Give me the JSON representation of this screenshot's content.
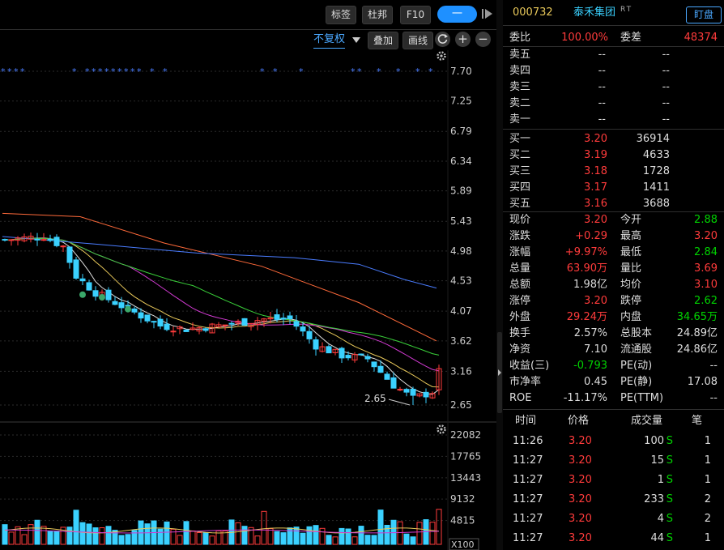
{
  "toolbar": {
    "tag_label": "标签",
    "dubang_label": "杜邦",
    "f10_label": "F10",
    "minus_label": "一",
    "fuquan_label": "不复权",
    "overlay_label": "叠加",
    "draw_label": "画线"
  },
  "stock": {
    "code": "000732",
    "name": "泰禾集团",
    "badges": "RT",
    "watch_label": "盯盘"
  },
  "order_book": {
    "weibi_label": "委比",
    "weibi_value": "100.00%",
    "weicha_label": "委差",
    "weicha_value": "48374",
    "asks": [
      {
        "label": "卖五",
        "price": "--",
        "volume": "--"
      },
      {
        "label": "卖四",
        "price": "--",
        "volume": "--"
      },
      {
        "label": "卖三",
        "price": "--",
        "volume": "--"
      },
      {
        "label": "卖二",
        "price": "--",
        "volume": "--"
      },
      {
        "label": "卖一",
        "price": "--",
        "volume": "--"
      }
    ],
    "bids": [
      {
        "label": "买一",
        "price": "3.20",
        "volume": "36914"
      },
      {
        "label": "买二",
        "price": "3.19",
        "volume": "4633"
      },
      {
        "label": "买三",
        "price": "3.18",
        "volume": "1728"
      },
      {
        "label": "买四",
        "price": "3.17",
        "volume": "1411"
      },
      {
        "label": "买五",
        "price": "3.16",
        "volume": "3688"
      }
    ]
  },
  "quote": [
    {
      "l1": "现价",
      "v1": "3.20",
      "c1": "red",
      "l2": "今开",
      "v2": "2.88",
      "c2": "green"
    },
    {
      "l1": "涨跌",
      "v1": "+0.29",
      "c1": "red",
      "l2": "最高",
      "v2": "3.20",
      "c2": "red"
    },
    {
      "l1": "涨幅",
      "v1": "+9.97%",
      "c1": "red",
      "l2": "最低",
      "v2": "2.84",
      "c2": "green"
    },
    {
      "l1": "总量",
      "v1": "63.90万",
      "c1": "red",
      "l2": "量比",
      "v2": "3.69",
      "c2": "red"
    },
    {
      "l1": "总额",
      "v1": "1.98亿",
      "c1": "white",
      "l2": "均价",
      "v2": "3.10",
      "c2": "red"
    },
    {
      "l1": "涨停",
      "v1": "3.20",
      "c1": "red",
      "l2": "跌停",
      "v2": "2.62",
      "c2": "green"
    },
    {
      "l1": "外盘",
      "v1": "29.24万",
      "c1": "red",
      "l2": "内盘",
      "v2": "34.65万",
      "c2": "green"
    },
    {
      "l1": "换手",
      "v1": "2.57%",
      "c1": "white",
      "l2": "总股本",
      "v2": "24.89亿",
      "c2": "white"
    },
    {
      "l1": "净资",
      "v1": "7.10",
      "c1": "white",
      "l2": "流通股",
      "v2": "24.86亿",
      "c2": "white"
    },
    {
      "l1": "收益(三)",
      "v1": "-0.793",
      "c1": "green",
      "l2": "PE(动)",
      "v2": "--",
      "c2": "white"
    },
    {
      "l1": "市净率",
      "v1": "0.45",
      "c1": "white",
      "l2": "PE(静)",
      "v2": "17.08",
      "c2": "white"
    },
    {
      "l1": "ROE",
      "v1": "-11.17%",
      "c1": "white",
      "l2": "PE(TTM)",
      "v2": "--",
      "c2": "white"
    }
  ],
  "ticks": {
    "headers": [
      "时间",
      "价格",
      "成交量",
      "笔"
    ],
    "rows": [
      {
        "time": "11:26",
        "price": "3.20",
        "vol": "100",
        "flag": "S",
        "count": "1"
      },
      {
        "time": "11:27",
        "price": "3.20",
        "vol": "15",
        "flag": "S",
        "count": "1"
      },
      {
        "time": "11:27",
        "price": "3.20",
        "vol": "1",
        "flag": "S",
        "count": "1"
      },
      {
        "time": "11:27",
        "price": "3.20",
        "vol": "233",
        "flag": "S",
        "count": "2"
      },
      {
        "time": "11:27",
        "price": "3.20",
        "vol": "4",
        "flag": "S",
        "count": "2"
      },
      {
        "time": "11:27",
        "price": "3.20",
        "vol": "44",
        "flag": "S",
        "count": "1"
      }
    ]
  },
  "colors": {
    "up": "#ff3b3b",
    "down": "#3ad1ff",
    "ma5": "#dddddd",
    "ma10": "#e8c85a",
    "ma20": "#d13ad1",
    "ma30": "#3ad13a",
    "ma60": "#ff6a3a",
    "ma120": "#4a7cff"
  },
  "chart_data": {
    "type": "candlestick",
    "price_ticks": [
      "7.70",
      "7.25",
      "6.79",
      "6.34",
      "5.89",
      "5.43",
      "4.98",
      "4.53",
      "4.07",
      "3.62",
      "3.16",
      "2.65"
    ],
    "low_label": "2.65",
    "volume_ticks": [
      "22082",
      "17765",
      "13443",
      "9132",
      "4815"
    ],
    "volume_unit": "X100",
    "ylim": [
      2.6,
      7.7
    ],
    "last_close": 3.2
  }
}
